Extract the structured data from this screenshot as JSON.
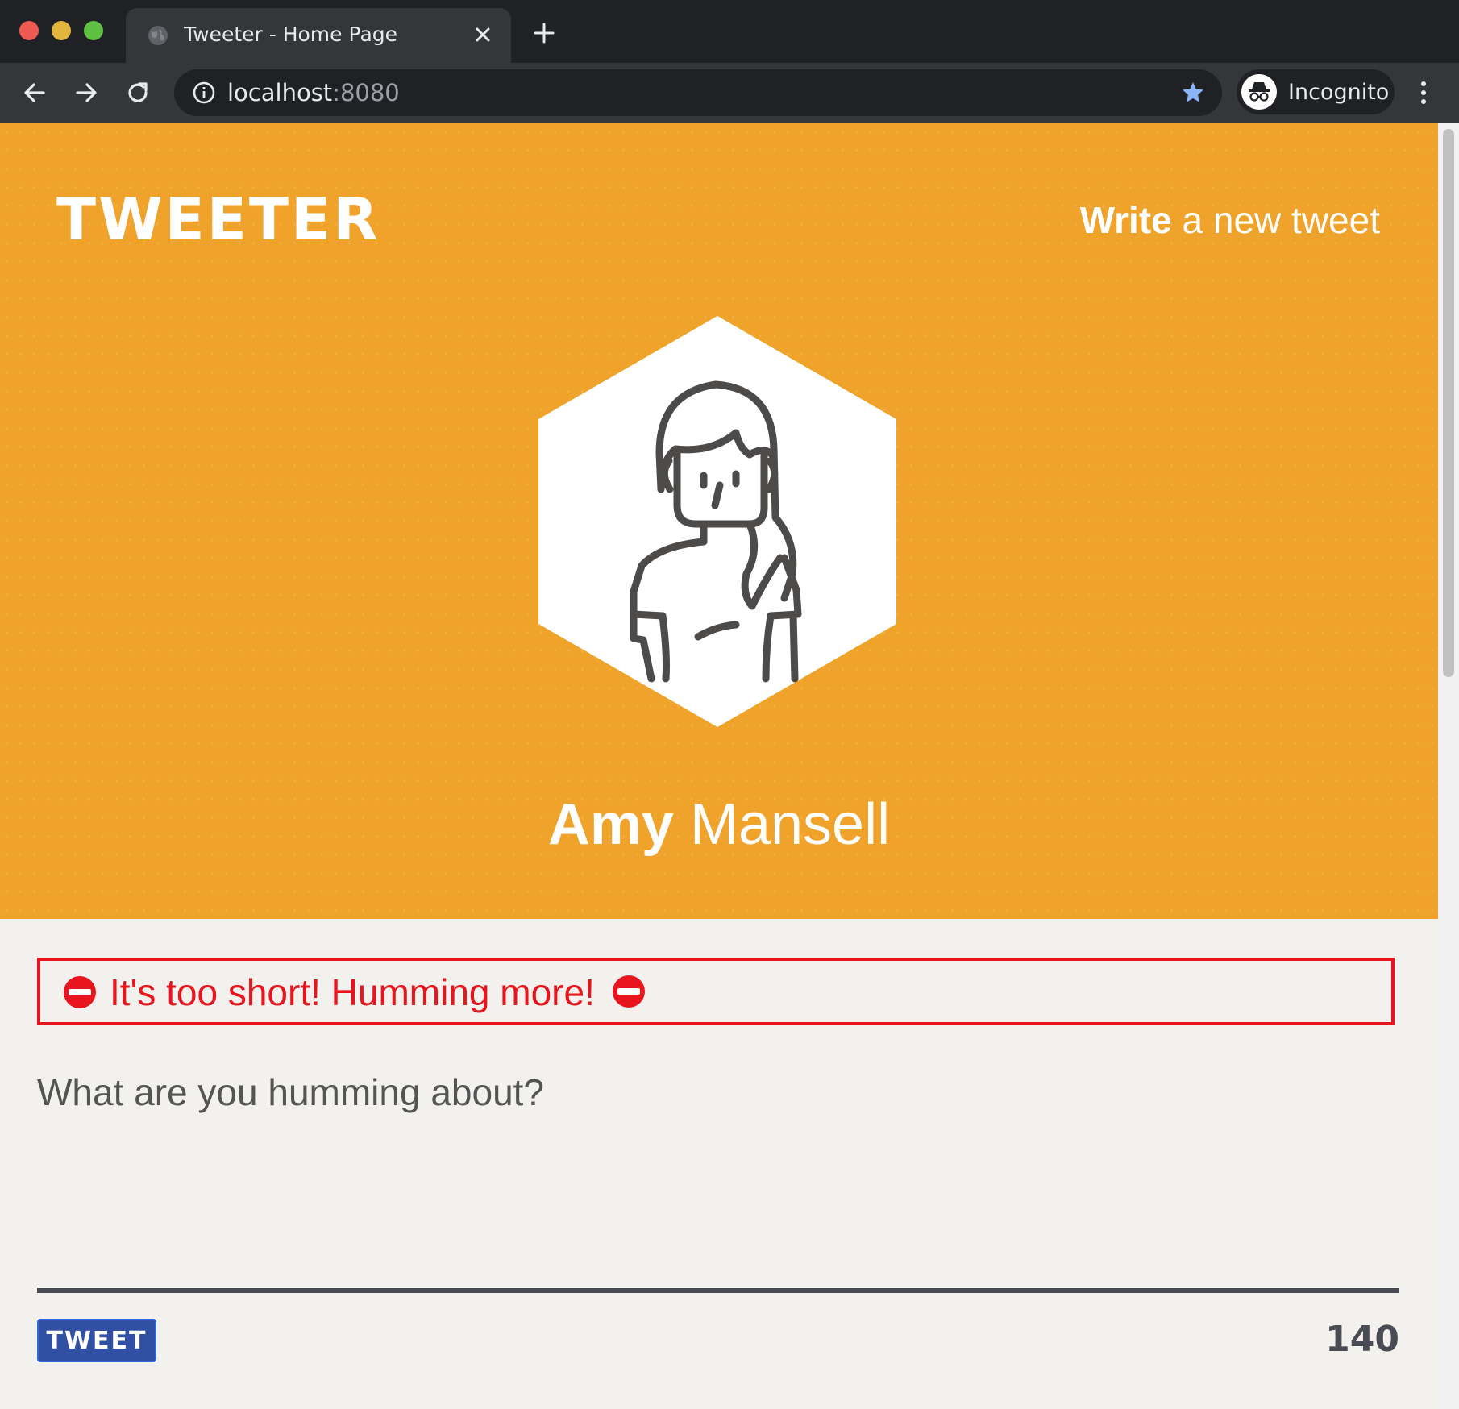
{
  "browser": {
    "tab_title": "Tweeter - Home Page",
    "url_host": "localhost",
    "url_port": ":8080",
    "profile_label": "Incognito"
  },
  "icons": {
    "globe": "globe-icon",
    "close": "close-icon",
    "new_tab": "plus-icon",
    "back": "arrow-left-icon",
    "forward": "arrow-right-icon",
    "reload": "reload-icon",
    "info": "info-icon",
    "bookmark": "star-icon",
    "incognito": "incognito-icon",
    "menu": "kebab-menu-icon",
    "error": "no-entry-icon"
  },
  "header": {
    "logo": "TWEETER",
    "write_bold": "Write",
    "write_rest": " a new tweet",
    "first_name": "Amy",
    "last_name": " Mansell"
  },
  "compose": {
    "error_message": "It's too short! Humming more!",
    "placeholder": "What are you humming about?",
    "button_label": "TWEET",
    "char_count": "140"
  },
  "colors": {
    "header_bg": "#f0a32b",
    "page_bg": "#f3f1ee",
    "error": "#e8151f",
    "button_bg": "#3150a4",
    "divider": "#494c52"
  }
}
